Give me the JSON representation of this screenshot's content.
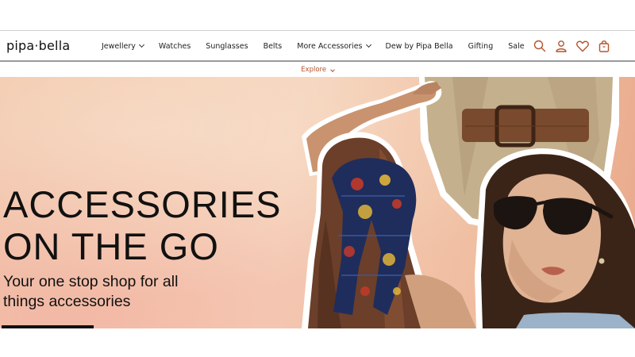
{
  "brand": {
    "logo_text": "pipa·bella"
  },
  "nav": {
    "items": [
      {
        "label": "Jewellery",
        "has_dropdown": true
      },
      {
        "label": "Watches",
        "has_dropdown": false
      },
      {
        "label": "Sunglasses",
        "has_dropdown": false
      },
      {
        "label": "Belts",
        "has_dropdown": false
      },
      {
        "label": "More Accessories",
        "has_dropdown": true
      },
      {
        "label": "Dew by Pipa Bella",
        "has_dropdown": false
      },
      {
        "label": "Gifting",
        "has_dropdown": false
      },
      {
        "label": "Sale",
        "has_dropdown": false
      }
    ]
  },
  "header_icons": [
    "search-icon",
    "account-icon",
    "wishlist-heart-icon",
    "cart-bag-icon"
  ],
  "explore": {
    "label": "Explore"
  },
  "hero": {
    "title_line1": "ACCESSORIES",
    "title_line2": "ON THE GO",
    "subtitle": "Your one stop shop for all things accessories"
  },
  "colors": {
    "accent": "#b3542c",
    "text": "#111111",
    "hero_bg": "#f4cdb0"
  }
}
